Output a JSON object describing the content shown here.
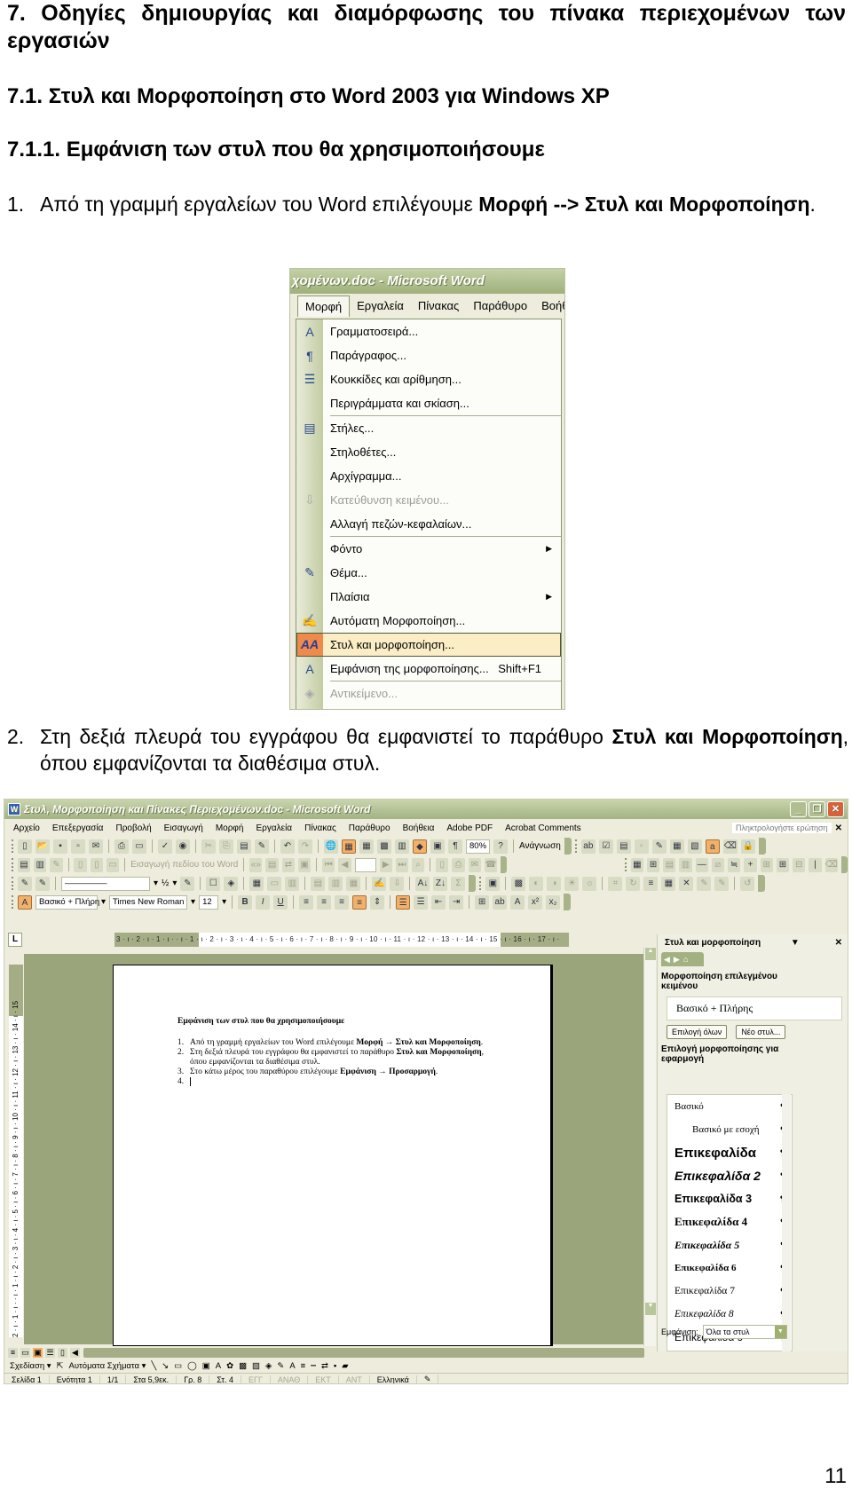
{
  "doc": {
    "heading1": "7. Οδηγίες δημιουργίας και διαμόρφωσης του πίνακα περιεχομένων των εργασιών",
    "heading2": "7.1. Στυλ και Μορφοποίηση στο Word 2003 για Windows XP",
    "heading3": "7.1.1. Εμφάνιση των στυλ που θα χρησιμοποιήσουμε",
    "step1": {
      "num": "1.",
      "text_a": "Από τη γραμμή εργαλείων του Word επιλέγουμε ",
      "bold_a": "Μορφή --> Στυλ και Μορφοποίηση",
      "text_b": "."
    },
    "step2": {
      "num": "2.",
      "text_a": "Στη δεξιά πλευρά του εγγράφου θα εμφανιστεί το παράθυρο ",
      "bold_a": "Στυλ και Μορφοποίηση",
      "text_b": ", όπου εμφανίζονται τα διαθέσιμα στυλ."
    },
    "page_number": "11"
  },
  "shot1": {
    "title": "χομένων.doc - Microsoft Word",
    "menubar": [
      "Μορφή",
      "Εργαλεία",
      "Πίνακας",
      "Παράθυρο",
      "Βοήθ"
    ],
    "items": [
      {
        "label": "Γραμματοσειρά...",
        "icon": "A",
        "icon_name": "font-icon"
      },
      {
        "label": "Παράγραφος...",
        "icon": "¶",
        "icon_name": "paragraph-icon"
      },
      {
        "label": "Κουκκίδες και αρίθμηση...",
        "icon": "☰",
        "icon_name": "bullets-icon"
      },
      {
        "label": "Περιγράμματα και σκίαση...",
        "icon": "",
        "icon_name": "borders-icon"
      },
      {
        "label": "Στήλες...",
        "icon": "▤",
        "icon_name": "columns-icon"
      },
      {
        "label": "Στηλοθέτες...",
        "icon": "",
        "icon_name": "tabs-icon"
      },
      {
        "label": "Αρχίγραμμα...",
        "icon": "",
        "icon_name": "dropcap-icon"
      },
      {
        "label": "Κατεύθυνση κειμένου...",
        "icon": "⇩",
        "icon_name": "text-direction-icon"
      },
      {
        "label": "Αλλαγή πεζών-κεφαλαίων...",
        "icon": "",
        "icon_name": "change-case-icon"
      },
      {
        "label": "Φόντο",
        "icon": "",
        "icon_name": "background-icon",
        "submenu": "▶"
      },
      {
        "label": "Θέμα...",
        "icon": "✎",
        "icon_name": "theme-icon"
      },
      {
        "label": "Πλαίσια",
        "icon": "",
        "icon_name": "frames-icon",
        "submenu": "▶"
      },
      {
        "label": "Αυτόματη Μορφοποίηση...",
        "icon": "✍",
        "icon_name": "autoformat-icon"
      },
      {
        "label": "Στυλ και μορφοποίηση...",
        "icon": "AA",
        "icon_name": "styles-formatting-icon"
      },
      {
        "label": "Εμφάνιση της μορφοποίησης...",
        "icon": "A",
        "icon_name": "reveal-formatting-icon",
        "shortcut": "Shift+F1"
      },
      {
        "label": "Αντικείμενο...",
        "icon": "◈",
        "icon_name": "object-icon"
      }
    ]
  },
  "shot2": {
    "title": "Στυλ, Μορφοποίηση και Πίνακες Περιεχομένων.doc - Microsoft Word",
    "window_controls": [
      "_",
      "❐",
      "✕"
    ],
    "menubar": [
      "Αρχείο",
      "Επεξεργασία",
      "Προβολή",
      "Εισαγωγή",
      "Μορφή",
      "Εργαλεία",
      "Πίνακας",
      "Παράθυρο",
      "Βοήθεια",
      "Adobe PDF",
      "Acrobat Comments"
    ],
    "ask_placeholder": "Πληκτρολογήστε ερώτηση",
    "zoom": "80%",
    "reading_label": "Ανάγνωση",
    "field_label": "Εισαγωγή πεδίου του Word",
    "line_weight": "½",
    "style_box": "Βασικό + Πλήρη",
    "font_box": "Times New Roman",
    "size_box": "12",
    "hruler_labels": "3 · ı · 2 · ı · 1 · ı ·   · ı · 1 · ı · 2 · ı · 3 · ı · 4 · ı · 5 · ı · 6 · ı · 7 · ı · 8 · ı · 9 · ı · 10 · ı · 11 · ı · 12 · ı · 13 · ı · 14 · ı · 15 · ı · 16 · ı · 17 · ı ·",
    "vruler_labels": "2 · ı · 1 · ı ·   · ı · 1 · ı · 2 · ı · 3 · ı · 4 · ı · 5 · ı · 6 · ı · 7 · ı · 8 · ı · 9 · ı · 10 · ı · 11 · ı · 12 · ı · 13 · ı · 14 · ı · 15",
    "page": {
      "title": "Εμφάνιση των στυλ που θα χρησιμοποιήσουμε",
      "items": [
        {
          "n": "1.",
          "a": "Από τη γραμμή εργαλείων του Word επιλέγουμε ",
          "b": "Μορφή → Στυλ και Μορφοποίηση",
          "c": "."
        },
        {
          "n": "2.",
          "a": "Στη δεξιά πλευρά του εγγράφου θα εμφανιστεί το παράθυρο ",
          "b": "Στυλ και Μορφοποίηση",
          "c": ", όπου εμφανίζονται τα διαθέσιμα στυλ."
        },
        {
          "n": "3.",
          "a": "Στο κάτω μέρος του παραθύρου επιλέγουμε ",
          "b": "Εμφάνιση → Προσαρμογή",
          "c": "."
        },
        {
          "n": "4.",
          "a": "",
          "b": "",
          "c": ""
        }
      ]
    },
    "taskpane": {
      "title": "Στυλ και μορφοποίηση",
      "close": "✕",
      "dropdown": "▼",
      "formatting_label": "Μορφοποίηση επιλεγμένου κειμένου",
      "current_format": "Βασικό + Πλήρης",
      "select_all": "Επιλογή όλων",
      "new_style": "Νέο στυλ...",
      "apply_label": "Επιλογή μορφοποίησης για εφαρμογή",
      "styles": [
        "Βασικό",
        "Βασικό με εσοχή",
        "Επικεφαλίδα",
        "Επικεφαλίδα 2",
        "Επικεφαλίδα 3",
        "Επικεφαλίδα 4",
        "Επικεφαλίδα 5",
        "Επικεφαλίδα 6",
        "Επικεφαλίδα 7",
        "Επικεφαλίδα 8",
        "Επικεφαλίδα 9"
      ],
      "pilcrow": "¶",
      "show_label": "Εμφάνιση:",
      "show_value": "Όλα τα στυλ"
    },
    "drawing": {
      "draw_label": "Σχεδίαση ▾",
      "autoshapes_label": "Αυτόματα Σχήματα ▾"
    },
    "status": {
      "page": "Σελίδα 1",
      "section": "Ενότητα 1",
      "pages": "1/1",
      "position": "Στα 5,9εκ.",
      "line": "Γρ. 8",
      "col": "Στ. 4",
      "rec": "ΕΓΓ",
      "trk": "ΑΝΑΘ",
      "ext": "ΕΚΤ",
      "ovr": "ΑΝΤ",
      "language": "Ελληνικά"
    }
  }
}
